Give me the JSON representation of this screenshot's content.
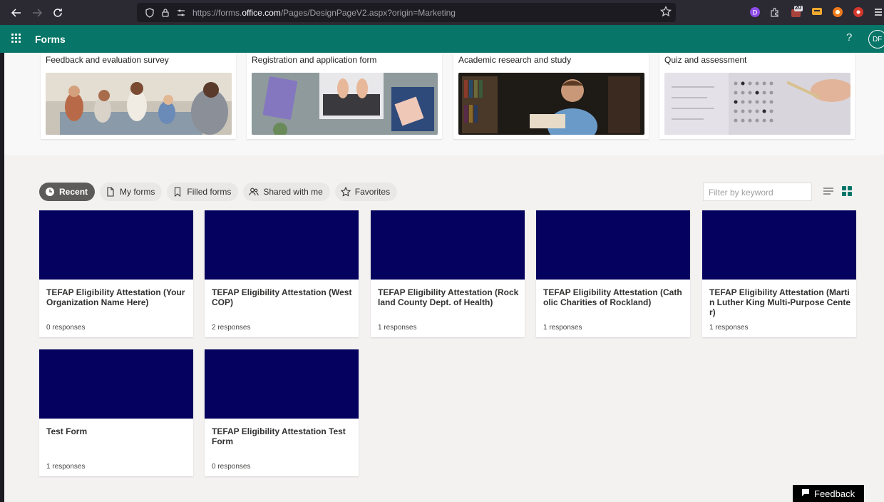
{
  "browser": {
    "url_prefix": "https://forms.",
    "url_domain": "office.com",
    "url_path": "/Pages/DesignPageV2.aspx?origin=Marketing",
    "ext_badge": "20"
  },
  "appbar": {
    "title": "Forms",
    "help": "?",
    "avatar_initials": "DF"
  },
  "templates": [
    {
      "title": "Feedback and evaluation survey"
    },
    {
      "title": "Registration and application form"
    },
    {
      "title": "Academic research and study"
    },
    {
      "title": "Quiz and assessment"
    }
  ],
  "tabs": [
    {
      "label": "Recent",
      "icon": "clock-icon"
    },
    {
      "label": "My forms",
      "icon": "document-icon"
    },
    {
      "label": "Filled forms",
      "icon": "bookmark-icon"
    },
    {
      "label": "Shared with me",
      "icon": "people-icon"
    },
    {
      "label": "Favorites",
      "icon": "star-icon"
    }
  ],
  "filter": {
    "placeholder": "Filter by keyword"
  },
  "forms": [
    {
      "title": "TEFAP Eligibility Attestation (Your Organization Name Here)",
      "responses": "0 responses"
    },
    {
      "title": "TEFAP Eligibility Attestation (WestCOP)",
      "responses": "2 responses"
    },
    {
      "title": "TEFAP Eligibility Attestation (Rockland County Dept. of Health)",
      "responses": "1 responses"
    },
    {
      "title": "TEFAP Eligibility Attestation (Catholic Charities of Rockland)",
      "responses": "1 responses"
    },
    {
      "title": "TEFAP Eligibility Attestation (Martin Luther King Multi-Purpose Center)",
      "responses": "1 responses"
    },
    {
      "title": "Test Form",
      "responses": "1 responses"
    },
    {
      "title": "TEFAP Eligibility Attestation Test Form",
      "responses": "0 responses"
    }
  ],
  "feedback": {
    "label": "Feedback"
  },
  "colors": {
    "brand": "#077568",
    "banner": "#04025e",
    "chrome": "#2b2a33"
  }
}
